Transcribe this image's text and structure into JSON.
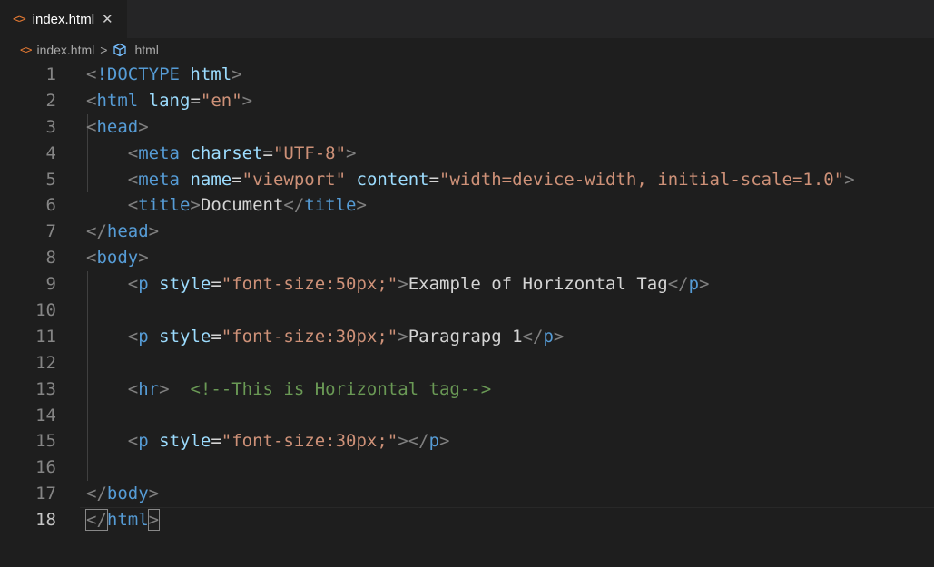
{
  "tab": {
    "icon": "html-code-icon",
    "label": "index.html",
    "close": "✕"
  },
  "breadcrumb": {
    "file": "index.html",
    "separator": ">",
    "symbol_icon": "cube-icon",
    "symbol": "html"
  },
  "colors": {
    "tag": "#569cd6",
    "attr": "#9cdcfe",
    "string": "#ce9178",
    "punct": "#808080",
    "comment": "#6a9955",
    "text": "#d4d4d4",
    "background": "#1e1e1e"
  },
  "current_line": 18,
  "lines": [
    {
      "n": "1",
      "tokens": [
        [
          "p",
          "<"
        ],
        [
          "t",
          "!DOCTYPE"
        ],
        [
          "x",
          " "
        ],
        [
          "a",
          "html"
        ],
        [
          "p",
          ">"
        ]
      ]
    },
    {
      "n": "2",
      "tokens": [
        [
          "p",
          "<"
        ],
        [
          "t",
          "html"
        ],
        [
          "x",
          " "
        ],
        [
          "a",
          "lang"
        ],
        [
          "x",
          "="
        ],
        [
          "s",
          "\"en\""
        ],
        [
          "p",
          ">"
        ]
      ]
    },
    {
      "n": "3",
      "tokens": [
        [
          "p",
          "<"
        ],
        [
          "t",
          "head"
        ],
        [
          "p",
          ">"
        ]
      ]
    },
    {
      "n": "4",
      "tokens": [
        [
          "x",
          "    "
        ],
        [
          "p",
          "<"
        ],
        [
          "t",
          "meta"
        ],
        [
          "x",
          " "
        ],
        [
          "a",
          "charset"
        ],
        [
          "x",
          "="
        ],
        [
          "s",
          "\"UTF-8\""
        ],
        [
          "p",
          ">"
        ]
      ]
    },
    {
      "n": "5",
      "tokens": [
        [
          "x",
          "    "
        ],
        [
          "p",
          "<"
        ],
        [
          "t",
          "meta"
        ],
        [
          "x",
          " "
        ],
        [
          "a",
          "name"
        ],
        [
          "x",
          "="
        ],
        [
          "s",
          "\"viewport\""
        ],
        [
          "x",
          " "
        ],
        [
          "a",
          "content"
        ],
        [
          "x",
          "="
        ],
        [
          "s",
          "\"width=device-width, initial-scale=1.0\""
        ],
        [
          "p",
          ">"
        ]
      ]
    },
    {
      "n": "6",
      "tokens": [
        [
          "x",
          "    "
        ],
        [
          "p",
          "<"
        ],
        [
          "t",
          "title"
        ],
        [
          "p",
          ">"
        ],
        [
          "x",
          "Document"
        ],
        [
          "p",
          "</"
        ],
        [
          "t",
          "title"
        ],
        [
          "p",
          ">"
        ]
      ]
    },
    {
      "n": "7",
      "tokens": [
        [
          "p",
          "</"
        ],
        [
          "t",
          "head"
        ],
        [
          "p",
          ">"
        ]
      ]
    },
    {
      "n": "8",
      "tokens": [
        [
          "p",
          "<"
        ],
        [
          "t",
          "body"
        ],
        [
          "p",
          ">"
        ]
      ]
    },
    {
      "n": "9",
      "tokens": [
        [
          "x",
          "    "
        ],
        [
          "p",
          "<"
        ],
        [
          "t",
          "p"
        ],
        [
          "x",
          " "
        ],
        [
          "a",
          "style"
        ],
        [
          "x",
          "="
        ],
        [
          "s",
          "\"font-size:50px;\""
        ],
        [
          "p",
          ">"
        ],
        [
          "x",
          "Example of Horizontal Tag"
        ],
        [
          "p",
          "</"
        ],
        [
          "t",
          "p"
        ],
        [
          "p",
          ">"
        ]
      ]
    },
    {
      "n": "10",
      "tokens": []
    },
    {
      "n": "11",
      "tokens": [
        [
          "x",
          "    "
        ],
        [
          "p",
          "<"
        ],
        [
          "t",
          "p"
        ],
        [
          "x",
          " "
        ],
        [
          "a",
          "style"
        ],
        [
          "x",
          "="
        ],
        [
          "s",
          "\"font-size:30px;\""
        ],
        [
          "p",
          ">"
        ],
        [
          "x",
          "Paragrapg 1"
        ],
        [
          "p",
          "</"
        ],
        [
          "t",
          "p"
        ],
        [
          "p",
          ">"
        ]
      ]
    },
    {
      "n": "12",
      "tokens": []
    },
    {
      "n": "13",
      "tokens": [
        [
          "x",
          "    "
        ],
        [
          "p",
          "<"
        ],
        [
          "t",
          "hr"
        ],
        [
          "p",
          ">"
        ],
        [
          "x",
          "  "
        ],
        [
          "c",
          "<!--This is Horizontal tag-->"
        ]
      ]
    },
    {
      "n": "14",
      "tokens": []
    },
    {
      "n": "15",
      "tokens": [
        [
          "x",
          "    "
        ],
        [
          "p",
          "<"
        ],
        [
          "t",
          "p"
        ],
        [
          "x",
          " "
        ],
        [
          "a",
          "style"
        ],
        [
          "x",
          "="
        ],
        [
          "s",
          "\"font-size:30px;\""
        ],
        [
          "p",
          ">"
        ],
        [
          "p",
          "</"
        ],
        [
          "t",
          "p"
        ],
        [
          "p",
          ">"
        ]
      ]
    },
    {
      "n": "16",
      "tokens": []
    },
    {
      "n": "17",
      "tokens": [
        [
          "p",
          "</"
        ],
        [
          "t",
          "body"
        ],
        [
          "p",
          ">"
        ]
      ]
    },
    {
      "n": "18",
      "tokens": [
        [
          "pb",
          "</"
        ],
        [
          "t",
          "html"
        ],
        [
          "pb",
          ">"
        ]
      ]
    }
  ]
}
